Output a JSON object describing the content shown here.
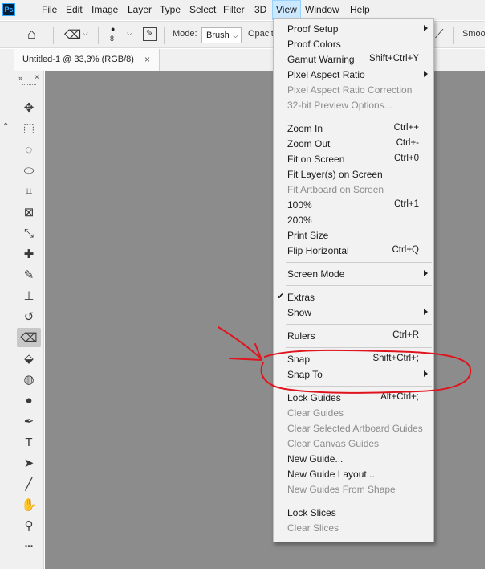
{
  "app": {
    "logo": "Ps"
  },
  "menubar": {
    "items": [
      "File",
      "Edit",
      "Image",
      "Layer",
      "Type",
      "Select",
      "Filter",
      "3D",
      "View",
      "Window",
      "Help"
    ]
  },
  "options_bar": {
    "brush_size": "8",
    "mode_label": "Mode:",
    "mode_value": "Brush",
    "opacity_label": "Opacit",
    "smoothing_label": "Smoo"
  },
  "document_tab": {
    "title": "Untitled-1 @ 33,3% (RGB/8)",
    "close": "×"
  },
  "view_menu": {
    "groups": [
      [
        {
          "label": "Proof Setup",
          "submenu": true
        },
        {
          "label": "Proof Colors"
        },
        {
          "label": "Gamut Warning",
          "shortcut": "Shift+Ctrl+Y"
        },
        {
          "label": "Pixel Aspect Ratio",
          "submenu": true
        },
        {
          "label": "Pixel Aspect Ratio Correction",
          "disabled": true
        },
        {
          "label": "32-bit Preview Options...",
          "disabled": true
        }
      ],
      [
        {
          "label": "Zoom In",
          "shortcut": "Ctrl++"
        },
        {
          "label": "Zoom Out",
          "shortcut": "Ctrl+-"
        },
        {
          "label": "Fit on Screen",
          "shortcut": "Ctrl+0"
        },
        {
          "label": "Fit Layer(s) on Screen"
        },
        {
          "label": "Fit Artboard on Screen",
          "disabled": true
        },
        {
          "label": "100%",
          "shortcut": "Ctrl+1"
        },
        {
          "label": "200%"
        },
        {
          "label": "Print Size"
        },
        {
          "label": "Flip Horizontal",
          "shortcut": "Ctrl+Q"
        }
      ],
      [
        {
          "label": "Screen Mode",
          "submenu": true
        }
      ],
      [
        {
          "label": "Extras",
          "checked": true
        },
        {
          "label": "Show",
          "submenu": true
        }
      ],
      [
        {
          "label": "Rulers",
          "shortcut": "Ctrl+R"
        }
      ],
      [
        {
          "label": "Snap",
          "shortcut": "Shift+Ctrl+;"
        },
        {
          "label": "Snap To",
          "submenu": true
        }
      ],
      [
        {
          "label": "Lock Guides",
          "shortcut": "Alt+Ctrl+;"
        },
        {
          "label": "Clear Guides",
          "disabled": true
        },
        {
          "label": "Clear Selected Artboard Guides",
          "disabled": true
        },
        {
          "label": "Clear Canvas Guides",
          "disabled": true
        },
        {
          "label": "New Guide..."
        },
        {
          "label": "New Guide Layout..."
        },
        {
          "label": "New Guides From Shape",
          "disabled": true
        }
      ],
      [
        {
          "label": "Lock Slices"
        },
        {
          "label": "Clear Slices",
          "disabled": true
        }
      ]
    ]
  },
  "tools": [
    {
      "icon": "move-icon",
      "glyph": "✥"
    },
    {
      "icon": "marquee-icon",
      "glyph": "⬚"
    },
    {
      "icon": "lasso-icon",
      "glyph": "◌"
    },
    {
      "icon": "quick-select-icon",
      "glyph": "⬭"
    },
    {
      "icon": "crop-icon",
      "glyph": "⌗"
    },
    {
      "icon": "frame-icon",
      "glyph": "⊠"
    },
    {
      "icon": "eyedropper-icon",
      "glyph": "⤡"
    },
    {
      "icon": "healing-brush-icon",
      "glyph": "✚"
    },
    {
      "icon": "brush-icon",
      "glyph": "✎"
    },
    {
      "icon": "stamp-icon",
      "glyph": "⊥"
    },
    {
      "icon": "history-brush-icon",
      "glyph": "↺"
    },
    {
      "icon": "eraser-icon",
      "glyph": "⌫",
      "active": true
    },
    {
      "icon": "paint-bucket-icon",
      "glyph": "⬙"
    },
    {
      "icon": "blur-icon",
      "glyph": "◍"
    },
    {
      "icon": "dodge-icon",
      "glyph": "●"
    },
    {
      "icon": "pen-icon",
      "glyph": "✒"
    },
    {
      "icon": "type-icon",
      "glyph": "T"
    },
    {
      "icon": "path-select-icon",
      "glyph": "➤"
    },
    {
      "icon": "line-icon",
      "glyph": "╱"
    },
    {
      "icon": "hand-icon",
      "glyph": "✋"
    },
    {
      "icon": "zoom-icon",
      "glyph": "⚲"
    },
    {
      "icon": "more-tools-icon",
      "glyph": "•••"
    }
  ],
  "colors": {
    "accent": "#cce8ff",
    "annotation": "#e0141e",
    "canvas": "#8c8c8c"
  }
}
